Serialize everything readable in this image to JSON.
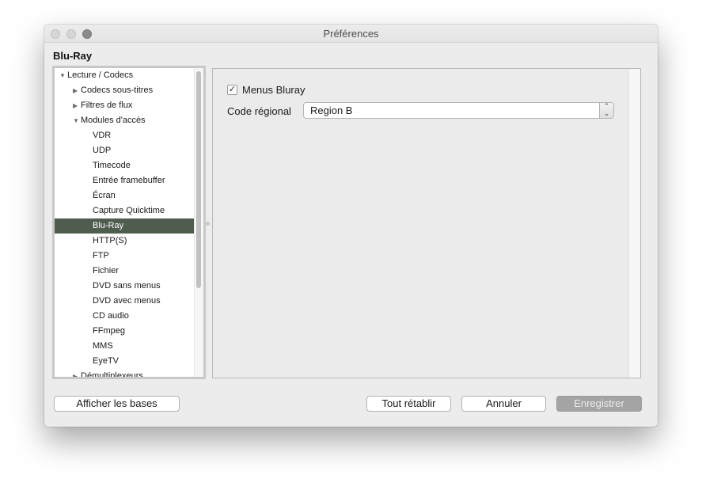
{
  "window": {
    "title": "Préférences"
  },
  "section": {
    "title": "Blu-Ray"
  },
  "tree": {
    "items": [
      {
        "label": "Lecture / Codecs",
        "level": 0,
        "arrow": "▼",
        "selected": false
      },
      {
        "label": "Codecs sous-titres",
        "level": 1,
        "arrow": "▶",
        "selected": false
      },
      {
        "label": "Filtres de flux",
        "level": 1,
        "arrow": "▶",
        "selected": false
      },
      {
        "label": "Modules d'accès",
        "level": 1,
        "arrow": "▼",
        "selected": false
      },
      {
        "label": "VDR",
        "level": 2,
        "arrow": "",
        "selected": false
      },
      {
        "label": "UDP",
        "level": 2,
        "arrow": "",
        "selected": false
      },
      {
        "label": "Timecode",
        "level": 2,
        "arrow": "",
        "selected": false
      },
      {
        "label": "Entrée framebuffer",
        "level": 2,
        "arrow": "",
        "selected": false
      },
      {
        "label": "Écran",
        "level": 2,
        "arrow": "",
        "selected": false
      },
      {
        "label": "Capture Quicktime",
        "level": 2,
        "arrow": "",
        "selected": false
      },
      {
        "label": "Blu-Ray",
        "level": 2,
        "arrow": "",
        "selected": true
      },
      {
        "label": "HTTP(S)",
        "level": 2,
        "arrow": "",
        "selected": false
      },
      {
        "label": "FTP",
        "level": 2,
        "arrow": "",
        "selected": false
      },
      {
        "label": "Fichier",
        "level": 2,
        "arrow": "",
        "selected": false
      },
      {
        "label": "DVD sans menus",
        "level": 2,
        "arrow": "",
        "selected": false
      },
      {
        "label": "DVD avec menus",
        "level": 2,
        "arrow": "",
        "selected": false
      },
      {
        "label": "CD audio",
        "level": 2,
        "arrow": "",
        "selected": false
      },
      {
        "label": "FFmpeg",
        "level": 2,
        "arrow": "",
        "selected": false
      },
      {
        "label": "MMS",
        "level": 2,
        "arrow": "",
        "selected": false
      },
      {
        "label": "EyeTV",
        "level": 2,
        "arrow": "",
        "selected": false
      },
      {
        "label": "Démultiplexeurs",
        "level": 1,
        "arrow": "▶",
        "selected": false
      }
    ]
  },
  "settings": {
    "menus_bluray_label": "Menus Bluray",
    "menus_bluray_checked": true,
    "check_mark": "✓",
    "region_label": "Code régional",
    "region_value": "Region B"
  },
  "buttons": {
    "show_basic": "Afficher les bases",
    "reset_all": "Tout rétablir",
    "cancel": "Annuler",
    "save": "Enregistrer"
  },
  "colors": {
    "selection": "#4f5d4f",
    "save_disabled": "#a4a4a4"
  }
}
